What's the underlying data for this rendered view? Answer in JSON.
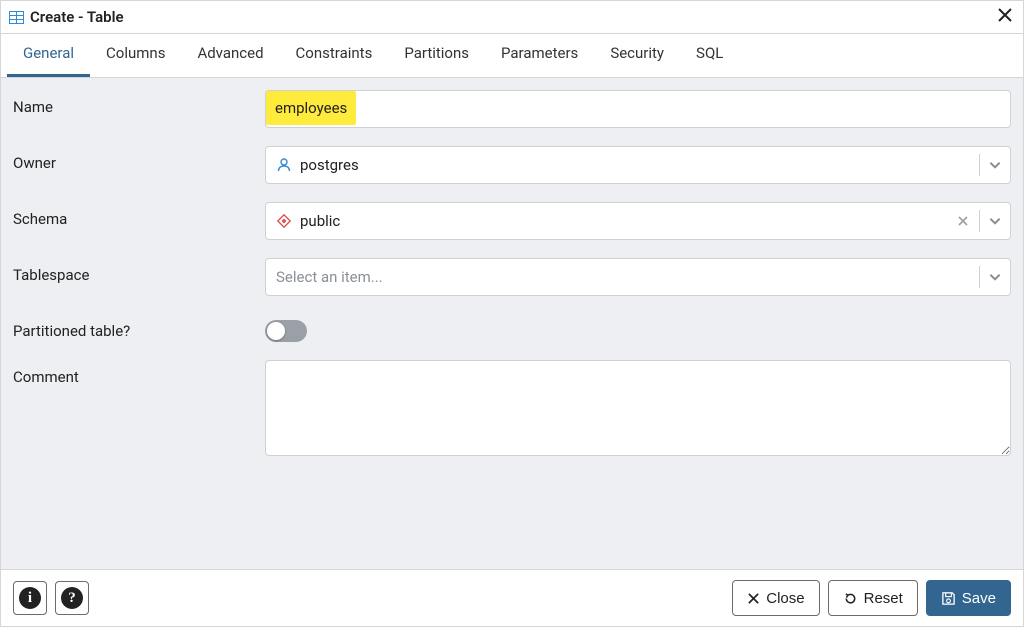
{
  "title": "Create - Table",
  "tabs": [
    "General",
    "Columns",
    "Advanced",
    "Constraints",
    "Partitions",
    "Parameters",
    "Security",
    "SQL"
  ],
  "activeTabIndex": 0,
  "labels": {
    "name": "Name",
    "owner": "Owner",
    "schema": "Schema",
    "tablespace": "Tablespace",
    "partitioned": "Partitioned table?",
    "comment": "Comment"
  },
  "fields": {
    "name": {
      "value": "employees"
    },
    "owner": {
      "value": "postgres"
    },
    "schema": {
      "value": "public"
    },
    "tablespace": {
      "value": "",
      "placeholder": "Select an item..."
    },
    "partitioned": {
      "on": false
    },
    "comment": {
      "value": ""
    }
  },
  "buttons": {
    "close": "Close",
    "reset": "Reset",
    "save": "Save"
  },
  "icons": {
    "user": "user-icon",
    "schema": "diamond-icon",
    "close_x": "✕",
    "chevron_down": "▾",
    "reset": "↺",
    "save": "save-icon",
    "info": "i",
    "help": "?"
  },
  "colors": {
    "accent": "#326690",
    "highlight": "#ffeb3b",
    "schema_icon": "#d9534f"
  }
}
